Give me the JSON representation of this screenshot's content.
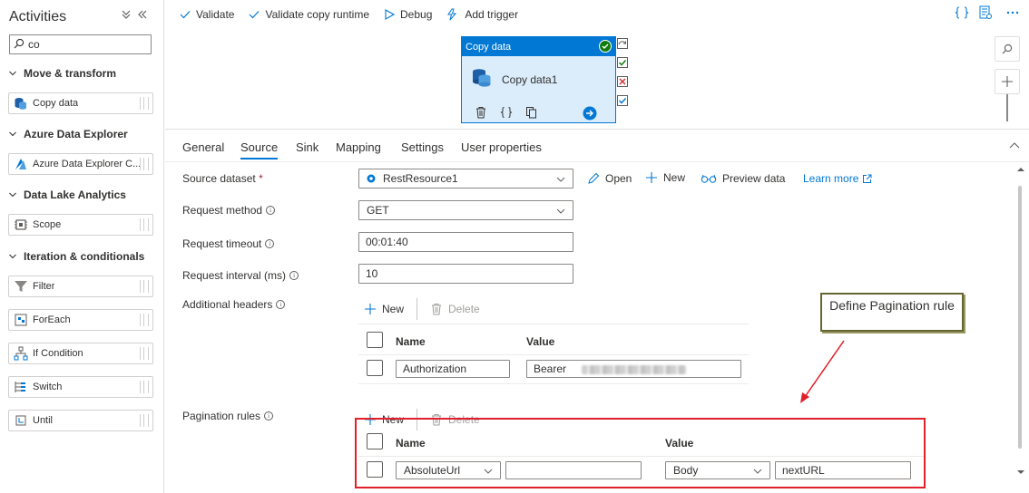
{
  "left_pane": {
    "title": "Activities",
    "collapse_icon": "double-chevron-down-icon",
    "hide_icon": "double-chevron-left-icon",
    "search": {
      "value": "co",
      "icon": "search-icon"
    },
    "categories": [
      {
        "label": "Move & transform",
        "items": [
          {
            "label": "Copy data",
            "icon": "copy-data-icon"
          }
        ]
      },
      {
        "label": "Azure Data Explorer",
        "items": [
          {
            "label": "Azure Data Explorer C...",
            "icon": "azure-data-explorer-icon"
          }
        ]
      },
      {
        "label": "Data Lake Analytics",
        "items": [
          {
            "label": "Scope",
            "icon": "scope-icon"
          }
        ]
      },
      {
        "label": "Iteration & conditionals",
        "items": [
          {
            "label": "Filter",
            "icon": "filter-icon"
          },
          {
            "label": "ForEach",
            "icon": "foreach-icon"
          },
          {
            "label": "If Condition",
            "icon": "if-condition-icon"
          },
          {
            "label": "Switch",
            "icon": "switch-icon"
          },
          {
            "label": "Until",
            "icon": "until-icon"
          }
        ]
      }
    ]
  },
  "toolbar": {
    "validate": "Validate",
    "validate_copy_runtime": "Validate copy runtime",
    "debug": "Debug",
    "add_trigger": "Add trigger"
  },
  "canvas": {
    "node": {
      "header": "Copy data",
      "name": "Copy data1",
      "status": "success"
    }
  },
  "tabs": [
    "General",
    "Source",
    "Sink",
    "Mapping",
    "Settings",
    "User properties"
  ],
  "active_tab": "Source",
  "form": {
    "source_dataset": {
      "label": "Source dataset",
      "required_mark": "*",
      "value": "RestResource1"
    },
    "dataset_actions": {
      "open": "Open",
      "new": "New",
      "preview": "Preview data",
      "learn_more": "Learn more"
    },
    "request_method": {
      "label": "Request method",
      "value": "GET"
    },
    "request_timeout": {
      "label": "Request timeout",
      "value": "00:01:40"
    },
    "request_interval": {
      "label": "Request interval (ms)",
      "value": "10"
    },
    "additional_headers": {
      "label": "Additional headers",
      "new": "New",
      "delete": "Delete",
      "col_name": "Name",
      "col_value": "Value",
      "row": {
        "name": "Authorization",
        "value": "Bearer"
      }
    },
    "pagination_rules": {
      "label": "Pagination rules",
      "new": "New",
      "delete": "Delete",
      "col_name": "Name",
      "col_value": "Value",
      "row": {
        "name": "AbsoluteUrl",
        "name_extra": "",
        "value_type": "Body",
        "value": "nextURL"
      }
    }
  },
  "annotation": {
    "callout": "Define Pagination rule",
    "color": "#e0202a"
  },
  "colors": {
    "accent": "#0078d4",
    "node_fill": "#dbecfa",
    "success": "#107c10",
    "error": "#d13438"
  }
}
